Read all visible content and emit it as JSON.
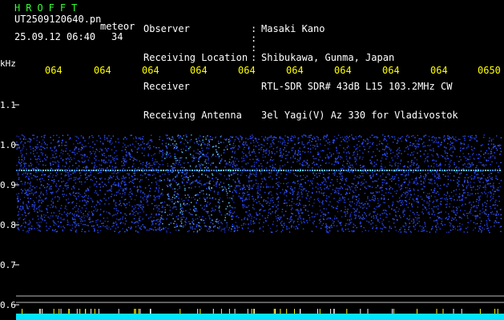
{
  "header": {
    "logo": "HROFFT",
    "filename": "UT2509120640.pn",
    "mode": "meteor",
    "date_time": "25.09.12 06:40",
    "count": "34"
  },
  "info": [
    {
      "label": "Observer",
      "value": "Masaki Kano"
    },
    {
      "label": "Receiving Location",
      "value": "Shibukawa, Gunma, Japan"
    },
    {
      "label": "Receiver",
      "value": "RTL-SDR SDR# 43dB L15 103.2MHz CW"
    },
    {
      "label": "Receiving Antenna",
      "value": "3el Yagi(V) Az 330 for Vladivostok"
    }
  ],
  "axis": {
    "unit": "kHz",
    "time_ticks": [
      "064",
      "064",
      "064",
      "064",
      "064",
      "064",
      "064",
      "064",
      "064",
      "0650"
    ],
    "freq_ticks": [
      "1.1",
      "1.0",
      "0.9",
      "0.8",
      "0.7",
      "0.6"
    ]
  },
  "colors": {
    "background": "#000000",
    "header_text": "#ffffff",
    "logo_text": "#33ff33",
    "tick_text": "#ffff00",
    "noise": "#2040ff",
    "noise_bright": "#60d0ff",
    "bottom_bar": "#00e5ff"
  }
}
